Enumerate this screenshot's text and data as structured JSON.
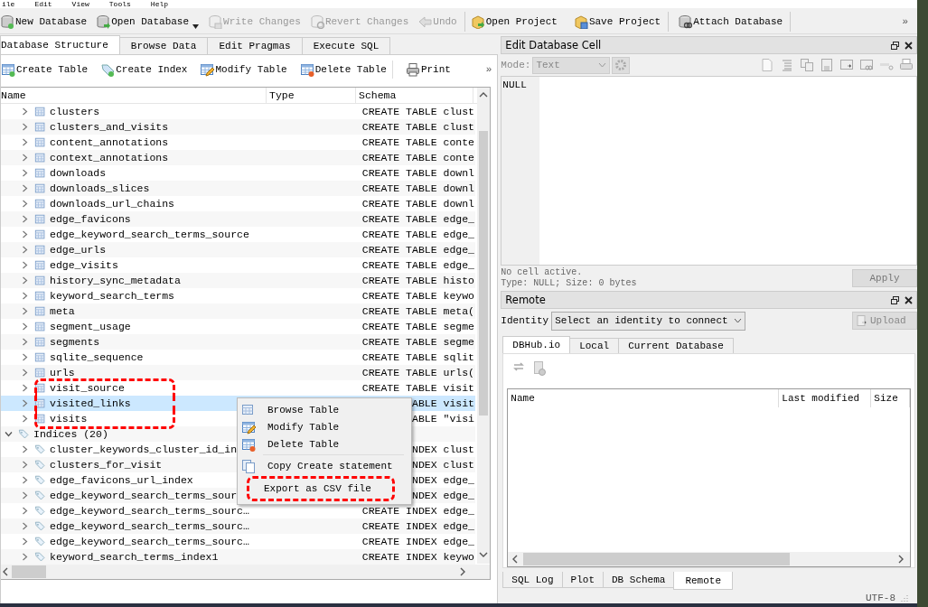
{
  "menu_bar": [
    "ile",
    "Edit",
    "View",
    "Tools",
    "Help"
  ],
  "toolbar": {
    "groups": [
      [
        {
          "label": "New Database",
          "disabled": false,
          "dropdown": false
        },
        {
          "label": "Open Database",
          "disabled": false,
          "dropdown": true
        },
        {
          "label": "Write Changes",
          "disabled": true,
          "dropdown": false
        },
        {
          "label": "Revert Changes",
          "disabled": true,
          "dropdown": false
        },
        {
          "label": "Undo",
          "disabled": true,
          "dropdown": false
        }
      ],
      [
        {
          "label": "Open Project",
          "disabled": false,
          "dropdown": false
        },
        {
          "label": "Save Project",
          "disabled": false,
          "dropdown": false
        }
      ],
      [
        {
          "label": "Attach Database",
          "disabled": false,
          "dropdown": false
        }
      ]
    ],
    "overflow": "»"
  },
  "main_tabs": [
    {
      "label": "Database Structure",
      "selected": true
    },
    {
      "label": "Browse Data",
      "selected": false
    },
    {
      "label": "Edit Pragmas",
      "selected": false
    },
    {
      "label": "Execute SQL",
      "selected": false
    }
  ],
  "structure_toolbar": {
    "items": [
      "Create Table",
      "Create Index",
      "Modify Table",
      "Delete Table",
      "Print"
    ],
    "overflow": "»"
  },
  "tree": {
    "columns": [
      "Name",
      "Type",
      "Schema"
    ],
    "items": [
      {
        "kind": "table-group",
        "children": [
          {
            "name": "clusters",
            "schema": "CREATE TABLE clust",
            "expanded": false,
            "selected": false,
            "annotated": false
          },
          {
            "name": "clusters_and_visits",
            "schema": "CREATE TABLE clust",
            "expanded": false,
            "selected": false,
            "annotated": false
          },
          {
            "name": "content_annotations",
            "schema": "CREATE TABLE conte",
            "expanded": false,
            "selected": false,
            "annotated": false
          },
          {
            "name": "context_annotations",
            "schema": "CREATE TABLE conte",
            "expanded": false,
            "selected": false,
            "annotated": false
          },
          {
            "name": "downloads",
            "schema": "CREATE TABLE downl",
            "expanded": false,
            "selected": false,
            "annotated": false
          },
          {
            "name": "downloads_slices",
            "schema": "CREATE TABLE downl",
            "expanded": false,
            "selected": false,
            "annotated": false
          },
          {
            "name": "downloads_url_chains",
            "schema": "CREATE TABLE downl",
            "expanded": false,
            "selected": false,
            "annotated": false
          },
          {
            "name": "edge_favicons",
            "schema": "CREATE TABLE edge_",
            "expanded": false,
            "selected": false,
            "annotated": false
          },
          {
            "name": "edge_keyword_search_terms_source",
            "schema": "CREATE TABLE edge_",
            "expanded": false,
            "selected": false,
            "annotated": false
          },
          {
            "name": "edge_urls",
            "schema": "CREATE TABLE edge_",
            "expanded": false,
            "selected": false,
            "annotated": false
          },
          {
            "name": "edge_visits",
            "schema": "CREATE TABLE edge_",
            "expanded": false,
            "selected": false,
            "annotated": false
          },
          {
            "name": "history_sync_metadata",
            "schema": "CREATE TABLE histo",
            "expanded": false,
            "selected": false,
            "annotated": false
          },
          {
            "name": "keyword_search_terms",
            "schema": "CREATE TABLE keywo",
            "expanded": false,
            "selected": false,
            "annotated": false
          },
          {
            "name": "meta",
            "schema": "CREATE TABLE meta(",
            "expanded": false,
            "selected": false,
            "annotated": false
          },
          {
            "name": "segment_usage",
            "schema": "CREATE TABLE segme",
            "expanded": false,
            "selected": false,
            "annotated": false
          },
          {
            "name": "segments",
            "schema": "CREATE TABLE segme",
            "expanded": false,
            "selected": false,
            "annotated": false
          },
          {
            "name": "sqlite_sequence",
            "schema": "CREATE TABLE sqlit",
            "expanded": false,
            "selected": false,
            "annotated": false
          },
          {
            "name": "urls",
            "schema": "CREATE TABLE urls(",
            "expanded": false,
            "selected": false,
            "annotated": false
          },
          {
            "name": "visit_source",
            "schema": "CREATE TABLE visit",
            "expanded": false,
            "selected": false,
            "annotated": true
          },
          {
            "name": "visited_links",
            "schema": "ABLE visit",
            "expanded": false,
            "selected": true,
            "annotated": true
          },
          {
            "name": "visits",
            "schema": "ABLE \"visi",
            "expanded": false,
            "selected": false,
            "annotated": true
          }
        ]
      },
      {
        "kind": "index-group",
        "label": "Indices (20)",
        "expanded": true,
        "children": [
          {
            "name": "cluster_keywords_cluster_id_in",
            "schema": "NDEX clust",
            "expanded": false,
            "selected": false,
            "annotated": false
          },
          {
            "name": "clusters_for_visit",
            "schema": "NDEX clust",
            "expanded": false,
            "selected": false,
            "annotated": false
          },
          {
            "name": "edge_favicons_url_index",
            "schema": "NDEX edge_",
            "expanded": false,
            "selected": false,
            "annotated": false
          },
          {
            "name": "edge_keyword_search_terms_sour",
            "schema": "NDEX edge_",
            "expanded": false,
            "selected": false,
            "annotated": false
          },
          {
            "name": "edge_keyword_search_terms_sourc…",
            "schema": "CREATE INDEX edge_",
            "expanded": false,
            "selected": false,
            "annotated": false
          },
          {
            "name": "edge_keyword_search_terms_sourc…",
            "schema": "CREATE INDEX edge_",
            "expanded": false,
            "selected": false,
            "annotated": false
          },
          {
            "name": "edge_keyword_search_terms_sourc…",
            "schema": "CREATE INDEX edge_",
            "expanded": false,
            "selected": false,
            "annotated": false
          },
          {
            "name": "keyword_search_terms_index1",
            "schema": "CREATE INDEX keywo",
            "expanded": false,
            "selected": false,
            "annotated": false
          }
        ]
      }
    ]
  },
  "context_menu": {
    "items": [
      {
        "kind": "item",
        "label": "Browse Table",
        "annotated": false
      },
      {
        "kind": "item",
        "label": "Modify Table",
        "annotated": false
      },
      {
        "kind": "item",
        "label": "Delete Table",
        "annotated": false
      },
      {
        "kind": "separator"
      },
      {
        "kind": "item",
        "label": "Copy Create statement",
        "annotated": false
      },
      {
        "kind": "item",
        "label": "Export as CSV file",
        "annotated": true
      }
    ]
  },
  "edit_cell": {
    "title": "Edit Database Cell",
    "mode_label": "Mode:",
    "mode": "Text",
    "value": "NULL",
    "status": [
      "No cell active.",
      "Type: NULL; Size: 0 bytes"
    ],
    "apply": "Apply"
  },
  "remote": {
    "title": "Remote",
    "identity_label": "Identity",
    "identity": "Select an identity to connect",
    "upload": "Upload",
    "tabs": [
      {
        "label": "DBHub.io",
        "selected": true
      },
      {
        "label": "Local",
        "selected": false
      },
      {
        "label": "Current Database",
        "selected": false
      }
    ],
    "columns": [
      "Name",
      "Last modified",
      "Size"
    ]
  },
  "bottom_tabs": [
    {
      "label": "SQL Log",
      "selected": false
    },
    {
      "label": "Plot",
      "selected": false
    },
    {
      "label": "DB Schema",
      "selected": false
    },
    {
      "label": "Remote",
      "selected": true
    }
  ],
  "status_bar": {
    "encoding": "UTF-8"
  }
}
